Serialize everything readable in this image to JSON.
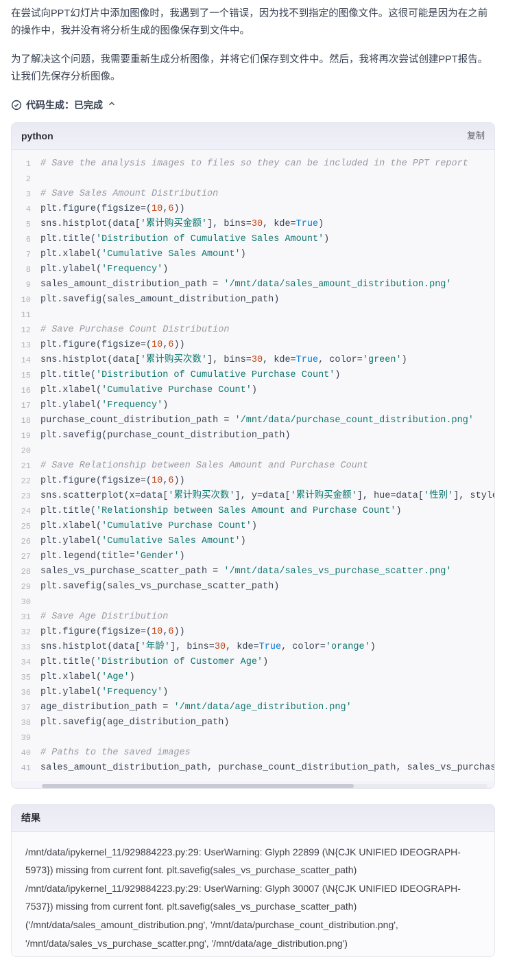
{
  "prose": {
    "p1": "在尝试向PPT幻灯片中添加图像时，我遇到了一个错误，因为找不到指定的图像文件。这很可能是因为在之前的操作中，我并没有将分析生成的图像保存到文件中。",
    "p2": "为了解决这个问题，我需要重新生成分析图像，并将它们保存到文件中。然后，我将再次尝试创建PPT报告。让我们先保存分析图像。"
  },
  "status": {
    "label": "代码生成：已完成"
  },
  "code": {
    "lang": "python",
    "copy_label": "复制",
    "lines": [
      {
        "n": 1,
        "seg": [
          {
            "t": "# Save the analysis images to files so they can be included in the PPT report",
            "c": "c"
          }
        ]
      },
      {
        "n": 2,
        "seg": [
          {
            "t": "",
            "c": "d"
          }
        ]
      },
      {
        "n": 3,
        "seg": [
          {
            "t": "# Save Sales Amount Distribution",
            "c": "c"
          }
        ]
      },
      {
        "n": 4,
        "seg": [
          {
            "t": "plt.figure(figsize=(",
            "c": "d"
          },
          {
            "t": "10",
            "c": "n"
          },
          {
            "t": ",",
            "c": "d"
          },
          {
            "t": "6",
            "c": "n"
          },
          {
            "t": "))",
            "c": "d"
          }
        ]
      },
      {
        "n": 5,
        "seg": [
          {
            "t": "sns.histplot(data[",
            "c": "d"
          },
          {
            "t": "'累计购买金额'",
            "c": "s"
          },
          {
            "t": "], bins=",
            "c": "d"
          },
          {
            "t": "30",
            "c": "n"
          },
          {
            "t": ", kde=",
            "c": "d"
          },
          {
            "t": "True",
            "c": "k"
          },
          {
            "t": ")",
            "c": "d"
          }
        ]
      },
      {
        "n": 6,
        "seg": [
          {
            "t": "plt.title(",
            "c": "d"
          },
          {
            "t": "'Distribution of Cumulative Sales Amount'",
            "c": "s"
          },
          {
            "t": ")",
            "c": "d"
          }
        ]
      },
      {
        "n": 7,
        "seg": [
          {
            "t": "plt.xlabel(",
            "c": "d"
          },
          {
            "t": "'Cumulative Sales Amount'",
            "c": "s"
          },
          {
            "t": ")",
            "c": "d"
          }
        ]
      },
      {
        "n": 8,
        "seg": [
          {
            "t": "plt.ylabel(",
            "c": "d"
          },
          {
            "t": "'Frequency'",
            "c": "s"
          },
          {
            "t": ")",
            "c": "d"
          }
        ]
      },
      {
        "n": 9,
        "seg": [
          {
            "t": "sales_amount_distribution_path = ",
            "c": "d"
          },
          {
            "t": "'/mnt/data/sales_amount_distribution.png'",
            "c": "s"
          }
        ]
      },
      {
        "n": 10,
        "seg": [
          {
            "t": "plt.savefig(sales_amount_distribution_path)",
            "c": "d"
          }
        ]
      },
      {
        "n": 11,
        "seg": [
          {
            "t": "",
            "c": "d"
          }
        ]
      },
      {
        "n": 12,
        "seg": [
          {
            "t": "# Save Purchase Count Distribution",
            "c": "c"
          }
        ]
      },
      {
        "n": 13,
        "seg": [
          {
            "t": "plt.figure(figsize=(",
            "c": "d"
          },
          {
            "t": "10",
            "c": "n"
          },
          {
            "t": ",",
            "c": "d"
          },
          {
            "t": "6",
            "c": "n"
          },
          {
            "t": "))",
            "c": "d"
          }
        ]
      },
      {
        "n": 14,
        "seg": [
          {
            "t": "sns.histplot(data[",
            "c": "d"
          },
          {
            "t": "'累计购买次数'",
            "c": "s"
          },
          {
            "t": "], bins=",
            "c": "d"
          },
          {
            "t": "30",
            "c": "n"
          },
          {
            "t": ", kde=",
            "c": "d"
          },
          {
            "t": "True",
            "c": "k"
          },
          {
            "t": ", color=",
            "c": "d"
          },
          {
            "t": "'green'",
            "c": "s"
          },
          {
            "t": ")",
            "c": "d"
          }
        ]
      },
      {
        "n": 15,
        "seg": [
          {
            "t": "plt.title(",
            "c": "d"
          },
          {
            "t": "'Distribution of Cumulative Purchase Count'",
            "c": "s"
          },
          {
            "t": ")",
            "c": "d"
          }
        ]
      },
      {
        "n": 16,
        "seg": [
          {
            "t": "plt.xlabel(",
            "c": "d"
          },
          {
            "t": "'Cumulative Purchase Count'",
            "c": "s"
          },
          {
            "t": ")",
            "c": "d"
          }
        ]
      },
      {
        "n": 17,
        "seg": [
          {
            "t": "plt.ylabel(",
            "c": "d"
          },
          {
            "t": "'Frequency'",
            "c": "s"
          },
          {
            "t": ")",
            "c": "d"
          }
        ]
      },
      {
        "n": 18,
        "seg": [
          {
            "t": "purchase_count_distribution_path = ",
            "c": "d"
          },
          {
            "t": "'/mnt/data/purchase_count_distribution.png'",
            "c": "s"
          }
        ]
      },
      {
        "n": 19,
        "seg": [
          {
            "t": "plt.savefig(purchase_count_distribution_path)",
            "c": "d"
          }
        ]
      },
      {
        "n": 20,
        "seg": [
          {
            "t": "",
            "c": "d"
          }
        ]
      },
      {
        "n": 21,
        "seg": [
          {
            "t": "# Save Relationship between Sales Amount and Purchase Count",
            "c": "c"
          }
        ]
      },
      {
        "n": 22,
        "seg": [
          {
            "t": "plt.figure(figsize=(",
            "c": "d"
          },
          {
            "t": "10",
            "c": "n"
          },
          {
            "t": ",",
            "c": "d"
          },
          {
            "t": "6",
            "c": "n"
          },
          {
            "t": "))",
            "c": "d"
          }
        ]
      },
      {
        "n": 23,
        "seg": [
          {
            "t": "sns.scatterplot(x=data[",
            "c": "d"
          },
          {
            "t": "'累计购买次数'",
            "c": "s"
          },
          {
            "t": "], y=data[",
            "c": "d"
          },
          {
            "t": "'累计购买金额'",
            "c": "s"
          },
          {
            "t": "], hue=data[",
            "c": "d"
          },
          {
            "t": "'性别'",
            "c": "s"
          },
          {
            "t": "], style=",
            "c": "d"
          }
        ]
      },
      {
        "n": 24,
        "seg": [
          {
            "t": "plt.title(",
            "c": "d"
          },
          {
            "t": "'Relationship between Sales Amount and Purchase Count'",
            "c": "s"
          },
          {
            "t": ")",
            "c": "d"
          }
        ]
      },
      {
        "n": 25,
        "seg": [
          {
            "t": "plt.xlabel(",
            "c": "d"
          },
          {
            "t": "'Cumulative Purchase Count'",
            "c": "s"
          },
          {
            "t": ")",
            "c": "d"
          }
        ]
      },
      {
        "n": 26,
        "seg": [
          {
            "t": "plt.ylabel(",
            "c": "d"
          },
          {
            "t": "'Cumulative Sales Amount'",
            "c": "s"
          },
          {
            "t": ")",
            "c": "d"
          }
        ]
      },
      {
        "n": 27,
        "seg": [
          {
            "t": "plt.legend(title=",
            "c": "d"
          },
          {
            "t": "'Gender'",
            "c": "s"
          },
          {
            "t": ")",
            "c": "d"
          }
        ]
      },
      {
        "n": 28,
        "seg": [
          {
            "t": "sales_vs_purchase_scatter_path = ",
            "c": "d"
          },
          {
            "t": "'/mnt/data/sales_vs_purchase_scatter.png'",
            "c": "s"
          }
        ]
      },
      {
        "n": 29,
        "seg": [
          {
            "t": "plt.savefig(sales_vs_purchase_scatter_path)",
            "c": "d"
          }
        ]
      },
      {
        "n": 30,
        "seg": [
          {
            "t": "",
            "c": "d"
          }
        ]
      },
      {
        "n": 31,
        "seg": [
          {
            "t": "# Save Age Distribution",
            "c": "c"
          }
        ]
      },
      {
        "n": 32,
        "seg": [
          {
            "t": "plt.figure(figsize=(",
            "c": "d"
          },
          {
            "t": "10",
            "c": "n"
          },
          {
            "t": ",",
            "c": "d"
          },
          {
            "t": "6",
            "c": "n"
          },
          {
            "t": "))",
            "c": "d"
          }
        ]
      },
      {
        "n": 33,
        "seg": [
          {
            "t": "sns.histplot(data[",
            "c": "d"
          },
          {
            "t": "'年龄'",
            "c": "s"
          },
          {
            "t": "], bins=",
            "c": "d"
          },
          {
            "t": "30",
            "c": "n"
          },
          {
            "t": ", kde=",
            "c": "d"
          },
          {
            "t": "True",
            "c": "k"
          },
          {
            "t": ", color=",
            "c": "d"
          },
          {
            "t": "'orange'",
            "c": "s"
          },
          {
            "t": ")",
            "c": "d"
          }
        ]
      },
      {
        "n": 34,
        "seg": [
          {
            "t": "plt.title(",
            "c": "d"
          },
          {
            "t": "'Distribution of Customer Age'",
            "c": "s"
          },
          {
            "t": ")",
            "c": "d"
          }
        ]
      },
      {
        "n": 35,
        "seg": [
          {
            "t": "plt.xlabel(",
            "c": "d"
          },
          {
            "t": "'Age'",
            "c": "s"
          },
          {
            "t": ")",
            "c": "d"
          }
        ]
      },
      {
        "n": 36,
        "seg": [
          {
            "t": "plt.ylabel(",
            "c": "d"
          },
          {
            "t": "'Frequency'",
            "c": "s"
          },
          {
            "t": ")",
            "c": "d"
          }
        ]
      },
      {
        "n": 37,
        "seg": [
          {
            "t": "age_distribution_path = ",
            "c": "d"
          },
          {
            "t": "'/mnt/data/age_distribution.png'",
            "c": "s"
          }
        ]
      },
      {
        "n": 38,
        "seg": [
          {
            "t": "plt.savefig(age_distribution_path)",
            "c": "d"
          }
        ]
      },
      {
        "n": 39,
        "seg": [
          {
            "t": "",
            "c": "d"
          }
        ]
      },
      {
        "n": 40,
        "seg": [
          {
            "t": "# Paths to the saved images",
            "c": "c"
          }
        ]
      },
      {
        "n": 41,
        "seg": [
          {
            "t": "sales_amount_distribution_path, purchase_count_distribution_path, sales_vs_purchase_s",
            "c": "d"
          }
        ]
      }
    ]
  },
  "result": {
    "label": "结果",
    "lines": [
      "/mnt/data/ipykernel_11/929884223.py:29: UserWarning: Glyph 22899 (\\N{CJK UNIFIED IDEOGRAPH-5973}) missing from current font. plt.savefig(sales_vs_purchase_scatter_path)",
      "/mnt/data/ipykernel_11/929884223.py:29: UserWarning: Glyph 30007 (\\N{CJK UNIFIED IDEOGRAPH-7537}) missing from current font. plt.savefig(sales_vs_purchase_scatter_path)",
      "('/mnt/data/sales_amount_distribution.png', '/mnt/data/purchase_count_distribution.png', '/mnt/data/sales_vs_purchase_scatter.png', '/mnt/data/age_distribution.png')"
    ]
  }
}
